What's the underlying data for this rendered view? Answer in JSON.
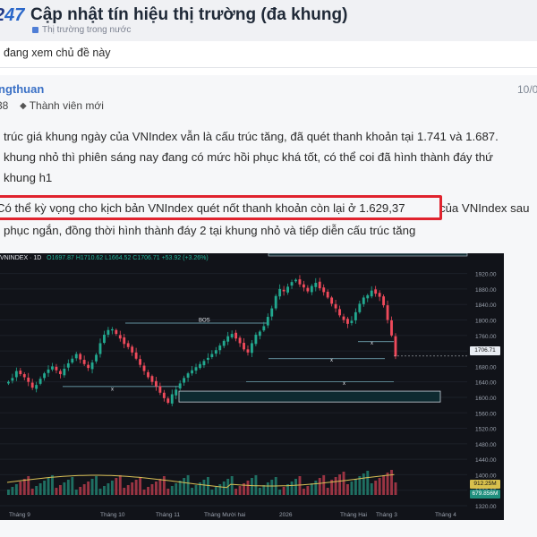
{
  "header": {
    "logo_fragment": "247",
    "title": "Cập nhật tín hiệu thị trường (đa khung)",
    "breadcrumb": "Thị trường trong nước",
    "viewing": "đang xem chủ đề này"
  },
  "post": {
    "username": "ngthuan",
    "date": "10/0",
    "post_count": "38",
    "rank": "Thành viên mới",
    "lines": [
      "trúc giá khung ngày của VNIndex vẫn là cấu trúc tăng, đã quét thanh khoản tại 1.741 và 1.687.",
      "khung nhỏ thì phiên sáng nay đang có mức hồi phục khá tốt, có thể coi đã hình thành đáy thứ",
      "khung h1",
      "Có thể kỳ vọng cho kịch bản VNIndex quét nốt thanh khoản còn lại ở 1.629,37",
      " của VNIndex sau",
      "phục ngắn, đồng thời hình thành đáy 2 tại khung nhỏ và tiếp diễn cấu trúc tăng"
    ]
  },
  "chart": {
    "symbol": "VNINDEX · 1D",
    "ohlc": "O1697.87  H1710.62  L1664.52  C1706.71  +53.92 (+3.26%)",
    "bos_label": "BOS",
    "current_price": "1706.71",
    "volume_badge_1": "912.25M",
    "volume_badge_2": "679.856M",
    "price_ticks": [
      "1920.00",
      "1880.00",
      "1840.00",
      "1800.00",
      "1760.00",
      "1720.00",
      "1680.00",
      "1640.00",
      "1600.00",
      "1560.00",
      "1520.00",
      "1480.00",
      "1440.00",
      "1400.00",
      "1360.00",
      "1320.00"
    ],
    "time_ticks": [
      "Tháng 9",
      "Tháng 10",
      "Tháng 11",
      "Tháng Mười hai",
      "2026",
      "Tháng Hai",
      "Tháng 3",
      "Tháng 4"
    ],
    "colors": {
      "up": "#22a88f",
      "down": "#ef4a5b",
      "line": "#d9c056"
    }
  },
  "chart_data": {
    "type": "candlestick",
    "symbol": "VNINDEX",
    "timeframe": "1D",
    "ylim": [
      1320,
      1940
    ],
    "price_ticks": [
      1920,
      1880,
      1840,
      1800,
      1760,
      1720,
      1680,
      1640,
      1600,
      1560,
      1520,
      1480,
      1440,
      1400,
      1360,
      1320
    ],
    "last_close": 1706.71,
    "change": "+53.92 (+3.26%)",
    "annotations": [
      "BOS",
      "x",
      "x",
      "x",
      "x"
    ],
    "x_labels": [
      "Tháng 9",
      "Tháng 10",
      "Tháng 11",
      "Tháng Mười hai",
      "2026",
      "Tháng Hai",
      "Tháng 3",
      "Tháng 4"
    ],
    "closes": [
      1640,
      1650,
      1668,
      1660,
      1652,
      1640,
      1625,
      1632,
      1648,
      1662,
      1672,
      1680,
      1670,
      1660,
      1674,
      1688,
      1700,
      1712,
      1698,
      1686,
      1676,
      1690,
      1710,
      1740,
      1762,
      1774,
      1776,
      1764,
      1752,
      1738,
      1730,
      1716,
      1700,
      1684,
      1668,
      1652,
      1640,
      1628,
      1612,
      1598,
      1586,
      1608,
      1620,
      1636,
      1650,
      1662,
      1670,
      1678,
      1686,
      1694,
      1702,
      1712,
      1722,
      1734,
      1746,
      1758,
      1764,
      1752,
      1740,
      1724,
      1716,
      1740,
      1762,
      1770,
      1784,
      1808,
      1830,
      1862,
      1880,
      1874,
      1886,
      1898,
      1904,
      1892,
      1884,
      1874,
      1888,
      1896,
      1882,
      1872,
      1858,
      1842,
      1830,
      1812,
      1800,
      1790,
      1798,
      1820,
      1842,
      1858,
      1864,
      1876,
      1868,
      1860,
      1838,
      1800,
      1760,
      1706
    ]
  }
}
